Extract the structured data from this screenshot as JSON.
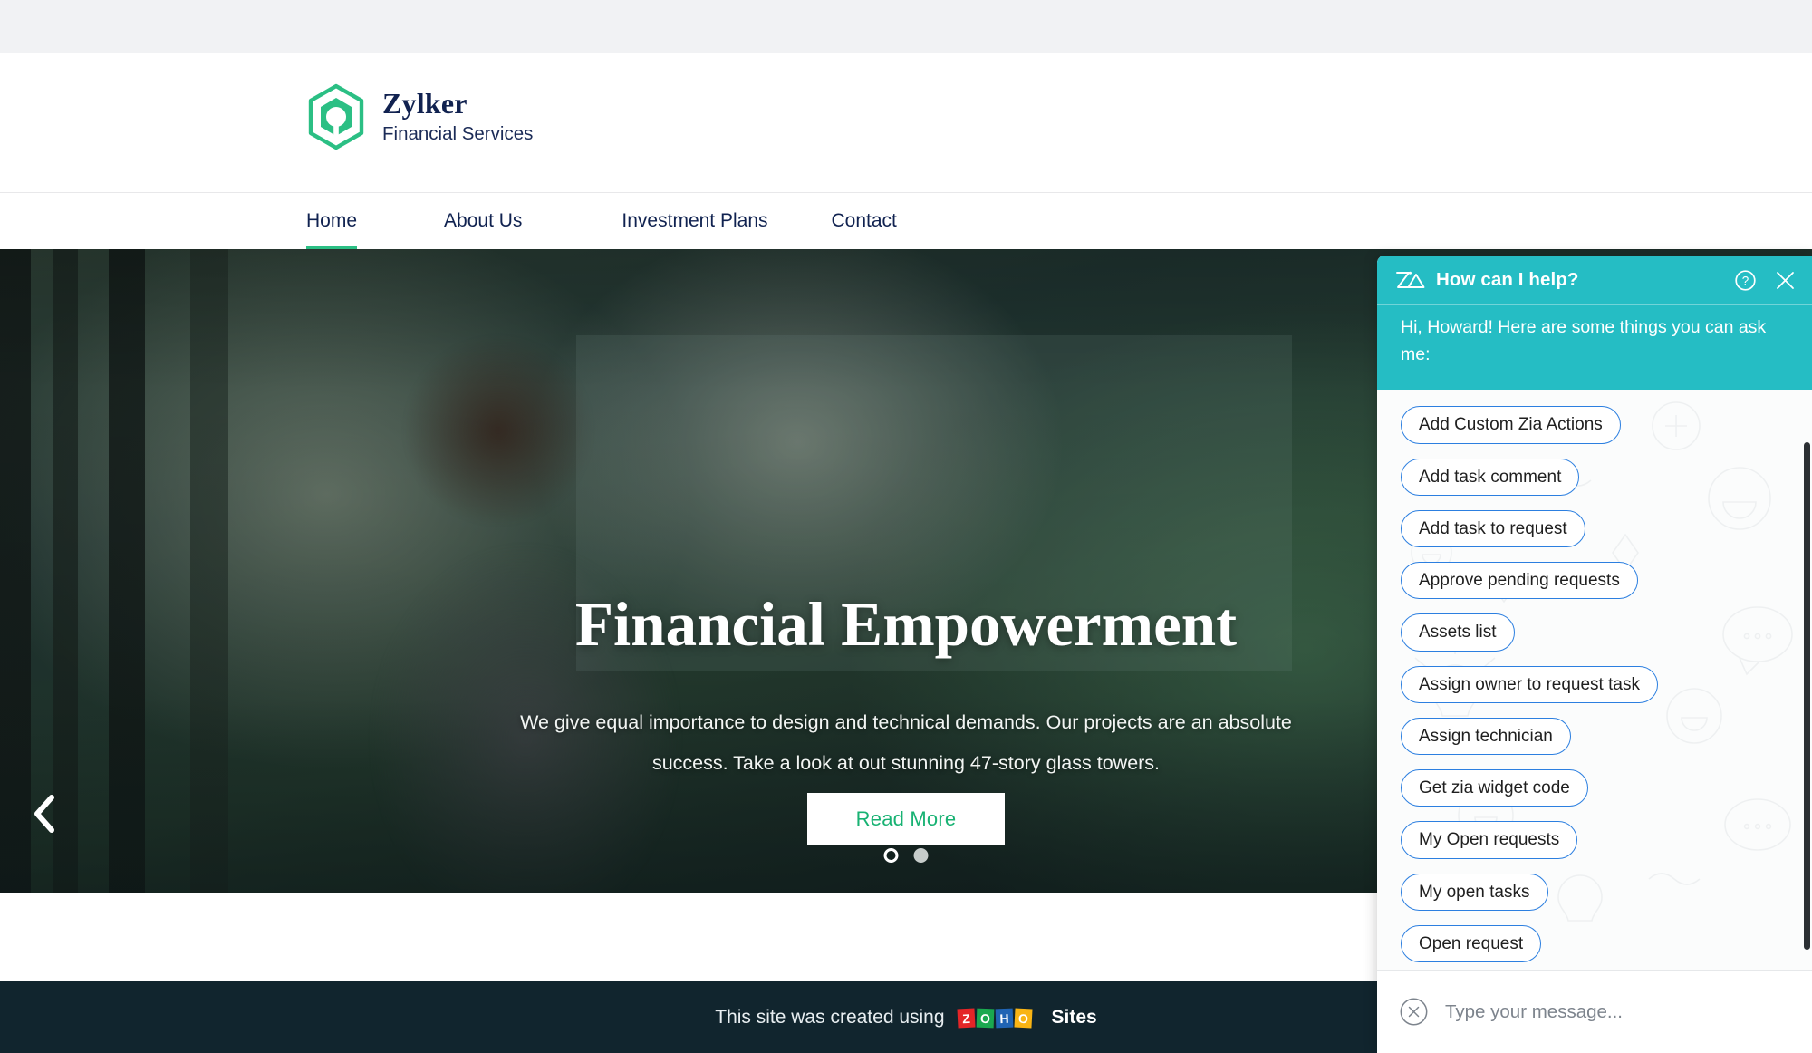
{
  "site": {
    "brand": {
      "name": "Zylker",
      "tagline": "Financial Services",
      "logo_icon": "hexagon-logo-icon",
      "logo_color": "#2bbf84",
      "name_color": "#112250"
    },
    "nav": {
      "items": [
        {
          "label": "Home",
          "active": true
        },
        {
          "label": "About Us",
          "active": false
        },
        {
          "label": "Investment Plans",
          "active": false
        },
        {
          "label": "Contact",
          "active": false
        }
      ],
      "active_underline_color": "#2bbf84"
    },
    "hero": {
      "title": "Financial Empowerment",
      "subtitle": "We give equal importance to design and technical demands. Our projects are an absolute success. Take a look at out stunning 47-story glass towers.",
      "cta_label": "Read More",
      "cta_text_color": "#18b273",
      "prev_arrow_icon": "chevron-left-icon",
      "dots": [
        {
          "state": "active"
        },
        {
          "state": "idle"
        }
      ]
    },
    "footer": {
      "text": "This site was created using",
      "zoho_tiles": [
        "Z",
        "O",
        "H",
        "O"
      ],
      "zoho_tile_colors": [
        "#e42527",
        "#1aa84f",
        "#2064b4",
        "#f9b414"
      ],
      "product": "Sites"
    }
  },
  "chat": {
    "logo_icon": "zia-logo-icon",
    "title": "How can I help?",
    "header_color": "#25bdc4",
    "help_icon": "question-circle-icon",
    "close_icon": "close-icon",
    "greeting": "Hi, Howard! Here are some things you can ask me:",
    "suggestions": [
      "Add Custom Zia Actions",
      "Add task comment",
      "Add task to request",
      "Approve pending requests",
      "Assets list",
      "Assign owner to request task",
      "Assign technician",
      "Get zia widget code",
      "My Open requests",
      "My open tasks",
      "Open request"
    ],
    "chip_border_color": "#2c7fe0",
    "input": {
      "value": "",
      "placeholder": "Type your message...",
      "clear_icon": "close-circle-icon"
    }
  }
}
